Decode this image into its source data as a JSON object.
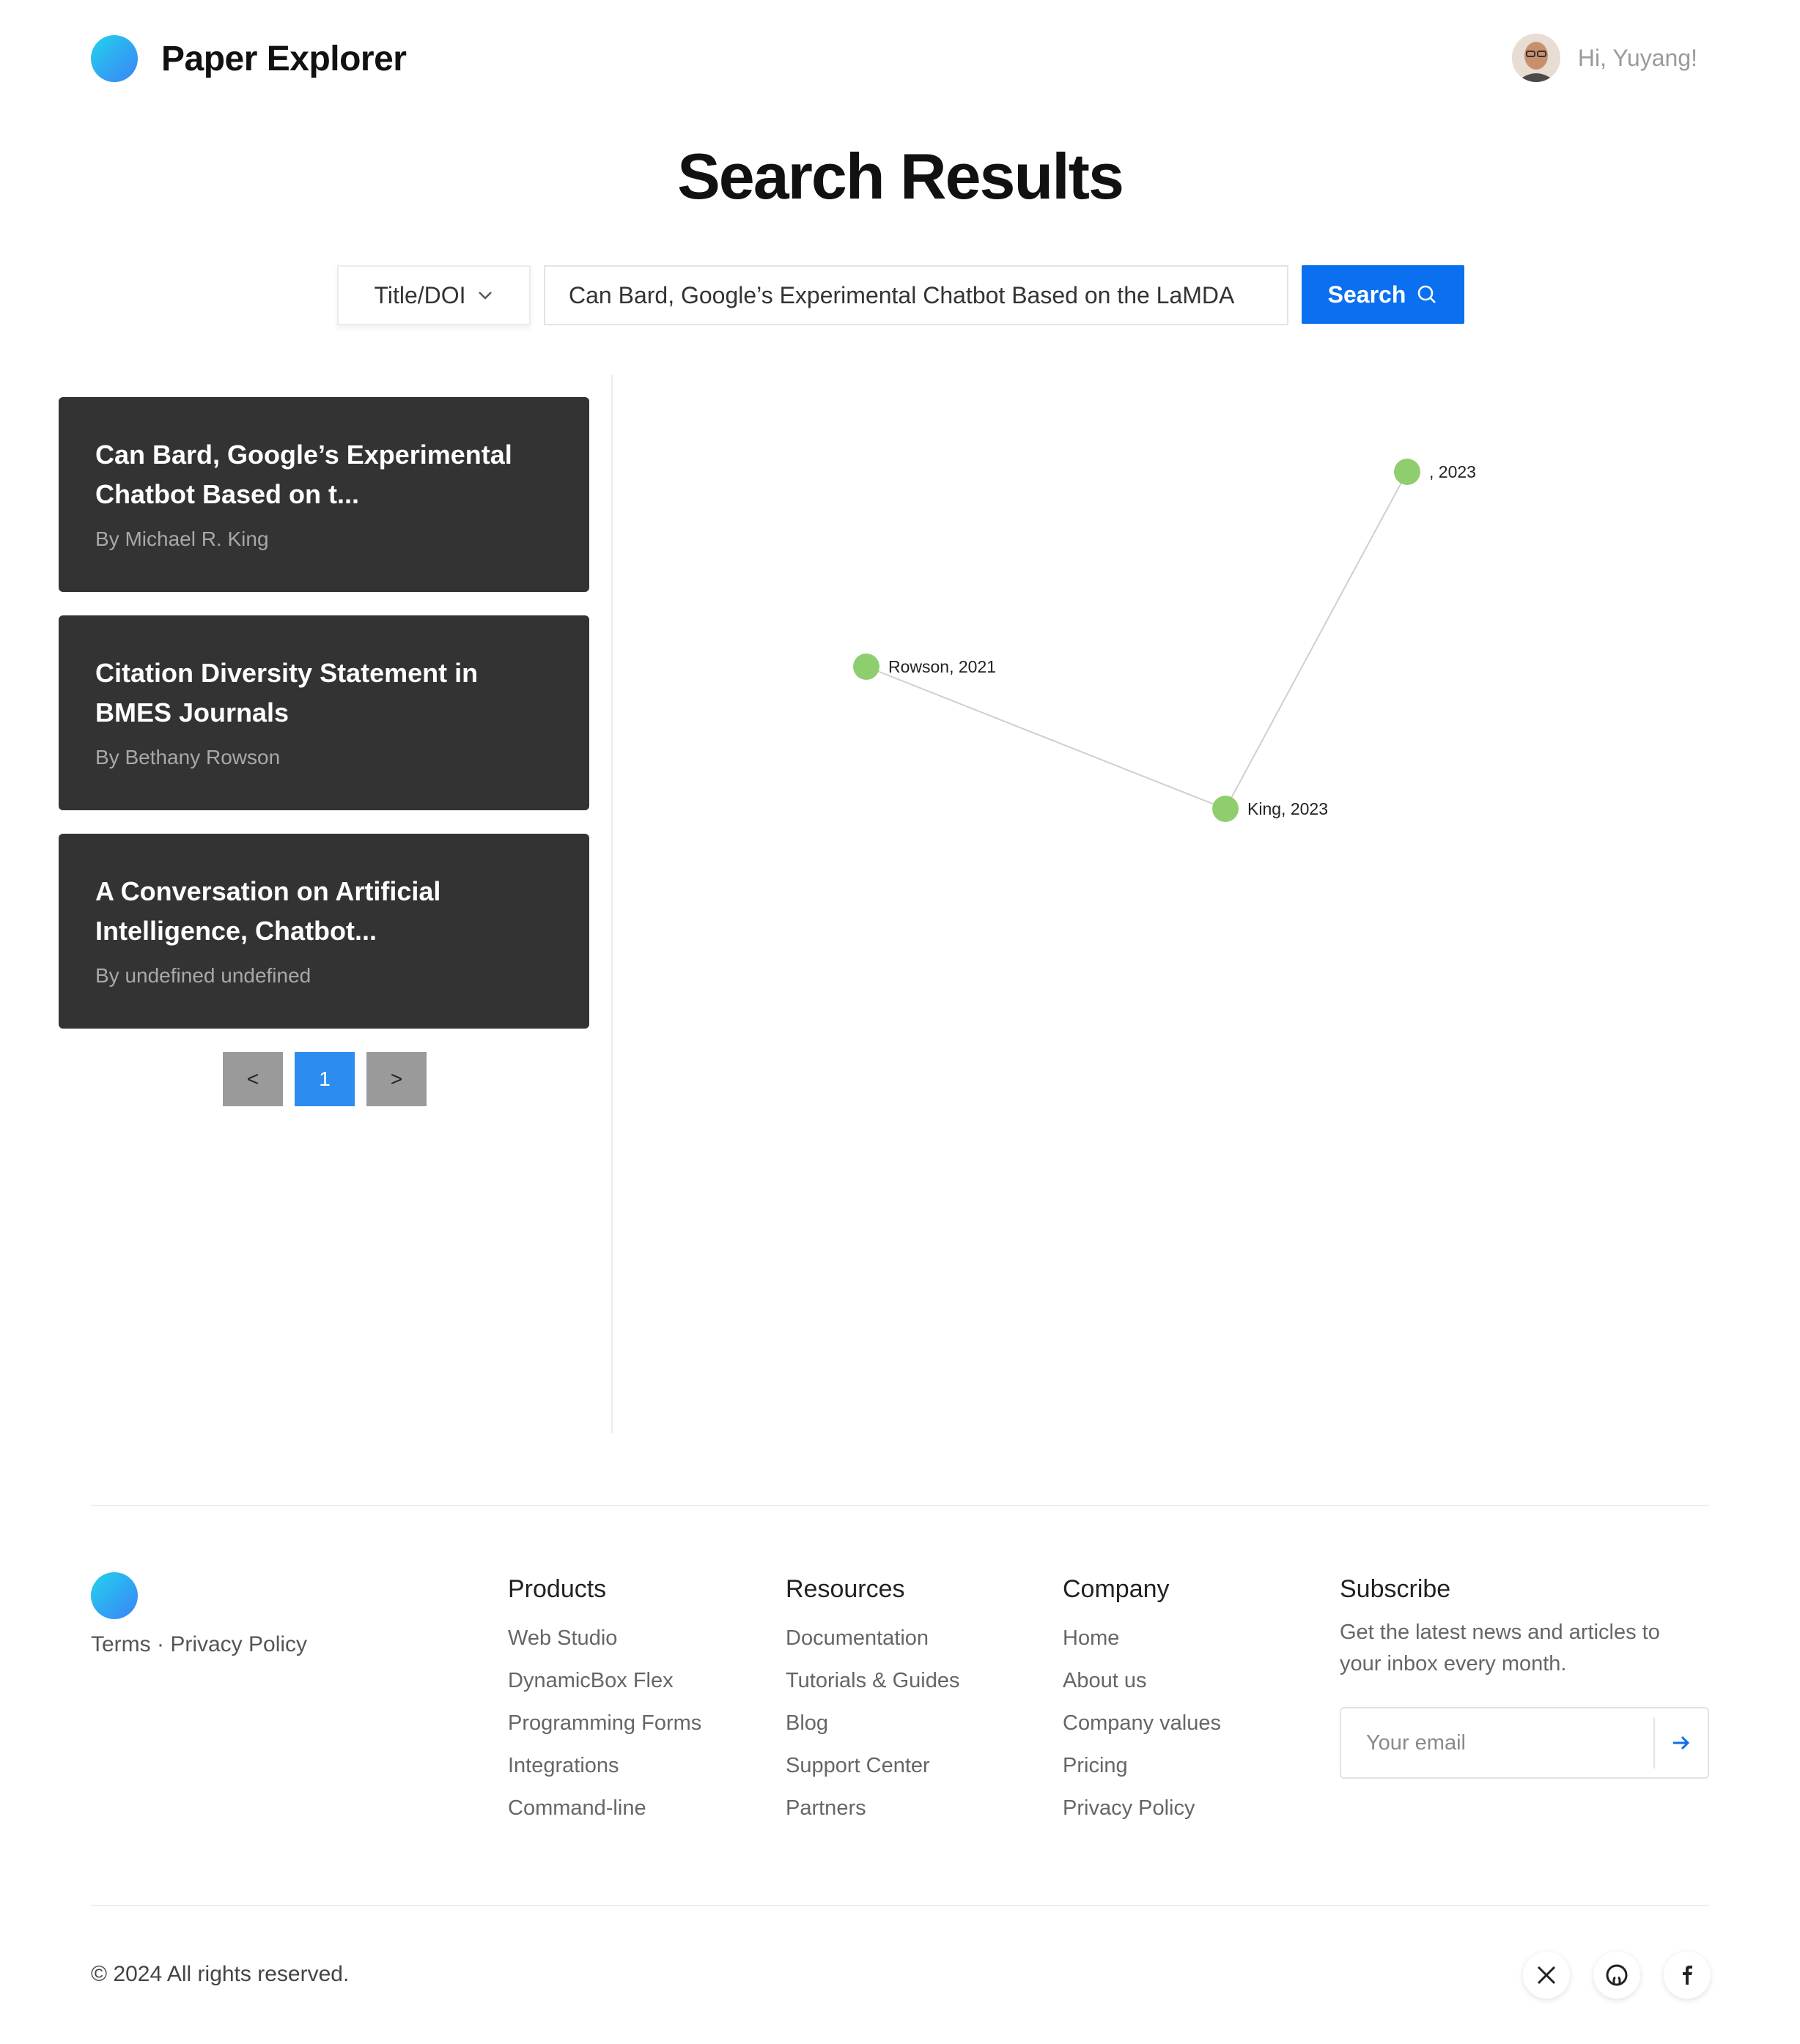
{
  "header": {
    "brand": "Paper Explorer",
    "greeting": "Hi, Yuyang!"
  },
  "page_title": "Search Results",
  "search": {
    "scope": "Title/DOI",
    "query": "Can Bard, Google’s Experimental Chatbot Based on the LaMDA",
    "button_label": "Search"
  },
  "results": [
    {
      "title": "Can Bard, Google’s Experimental Chatbot Based on t...",
      "author": "By Michael R. King"
    },
    {
      "title": "Citation Diversity Statement in BMES Journals",
      "author": "By Bethany Rowson"
    },
    {
      "title": "A Conversation on Artificial Intelligence, Chatbot...",
      "author": "By undefined undefined"
    }
  ],
  "pagination": {
    "prev": "<",
    "current": "1",
    "next": ">"
  },
  "graph": {
    "node_color": "#8fce6f",
    "nodes": [
      {
        "id": "a",
        "label": ", 2023"
      },
      {
        "id": "b",
        "label": "Rowson, 2021"
      },
      {
        "id": "c",
        "label": "King, 2023"
      }
    ],
    "edges": [
      [
        "b",
        "c"
      ],
      [
        "a",
        "c"
      ]
    ]
  },
  "footer": {
    "legal": "Terms · Privacy Policy",
    "products": {
      "heading": "Products",
      "links": [
        "Web Studio",
        "DynamicBox Flex",
        "Programming Forms",
        "Integrations",
        "Command-line"
      ]
    },
    "resources": {
      "heading": "Resources",
      "links": [
        "Documentation",
        "Tutorials & Guides",
        "Blog",
        "Support Center",
        "Partners"
      ]
    },
    "company": {
      "heading": "Company",
      "links": [
        "Home",
        "About us",
        "Company values",
        "Pricing",
        "Privacy Policy"
      ]
    },
    "subscribe": {
      "heading": "Subscribe",
      "text": "Get the latest news and articles to your inbox every month.",
      "placeholder": "Your email"
    },
    "copyright": "© 2024 All rights reserved.",
    "socials": [
      "x-icon",
      "github-icon",
      "facebook-icon"
    ]
  },
  "colors": {
    "accent": "#0a70f0",
    "card_bg": "#333333",
    "page_active": "#2d8cf0"
  }
}
